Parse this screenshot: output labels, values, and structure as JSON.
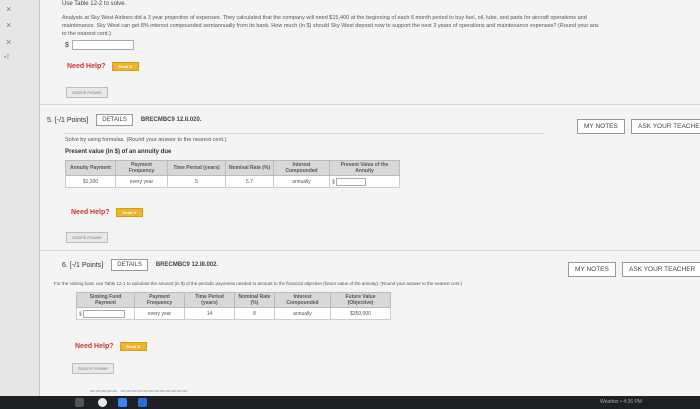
{
  "left_rail": {
    "marks": [
      "×",
      "×",
      "×"
    ],
    "tag": "•T"
  },
  "question_prev": {
    "table_ref": "Use Table 12-2 to solve.",
    "text_line1": "Analysts at Sky West Airlines did a 3 year projection of expenses. They calculated that the company will need $15,400 at the beginning of each 6 month period to buy fuel, oil, lube, and parts for aircraft operations and",
    "text_line2": "maintenance. Sky West can get 8% interest compounded semiannually from its bank. How much (in $) should Sky West deposit now to support the next 3 years of operations and maintenance expenses? (Round your ans",
    "text_line3": "to the nearest cent.)",
    "currency": "$",
    "need_help": "Need Help?",
    "read_it": "Read It",
    "submit": "Submit Answer"
  },
  "question5": {
    "number": "5.",
    "points": "[-/1 Points]",
    "details": "DETAILS",
    "code": "BRECMBC9 12.II.020.",
    "my_notes": "MY NOTES",
    "ask_teacher": "ASK YOUR TEACHER",
    "instruction": "Solve by using formulas. (Round your answer to the nearest cent.)",
    "table_title": "Present value (in $) of an annuity due",
    "headers": [
      "Annuity Payment",
      "Payment Frequency",
      "Time Period (years)",
      "Nominal Rate (%)",
      "Interest Compounded",
      "Present Value of the Annuity"
    ],
    "row": [
      "$1,300",
      "every year",
      "5",
      "5.7",
      "annually",
      "$"
    ],
    "need_help": "Need Help?",
    "read_it": "Read It",
    "submit": "Submit Answer"
  },
  "question6": {
    "number": "6.",
    "points": "[-/1 Points]",
    "details": "DETAILS",
    "code": "BRECMBC9 12.III.002.",
    "my_notes": "MY NOTES",
    "ask_teacher": "ASK YOUR TEACHER",
    "instruction": "For the sinking fund, use Table 12-1 to calculate the amount (in $) of the periodic payments needed to amount to the financial objective (future value of the annuity). (Round your answer to the nearest cent.)",
    "headers": [
      "Sinking Fund Payment",
      "Payment Frequency",
      "Time Period (years)",
      "Nominal Rate (%)",
      "Interest Compounded",
      "Future Value (Objective)"
    ],
    "row": [
      "$",
      "every year",
      "14",
      "8",
      "annually",
      "$350,000"
    ],
    "need_help": "Need Help?",
    "read_it": "Read It",
    "submit": "Submit Answer"
  },
  "taskbar": {
    "tray_text": "Weather • 4:36 PM"
  },
  "colors": {
    "read_it": "#f0b429",
    "need_help": "#cc3333",
    "sheet": "#f4f4f4"
  }
}
